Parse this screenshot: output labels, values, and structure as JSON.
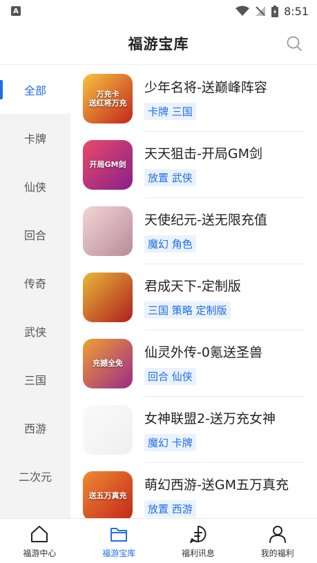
{
  "status_bar": {
    "notification_badge": "A",
    "time": "8:51"
  },
  "header": {
    "title": "福游宝库"
  },
  "categories": [
    {
      "label": "全部",
      "active": true
    },
    {
      "label": "卡牌",
      "active": false
    },
    {
      "label": "仙侠",
      "active": false
    },
    {
      "label": "回合",
      "active": false
    },
    {
      "label": "传奇",
      "active": false
    },
    {
      "label": "武侠",
      "active": false
    },
    {
      "label": "三国",
      "active": false
    },
    {
      "label": "西游",
      "active": false
    },
    {
      "label": "二次元",
      "active": false
    }
  ],
  "games": [
    {
      "title": "少年名将-送巅峰阵容",
      "tags": "卡牌 三国",
      "icon_text": "万充卡\n送红将万充",
      "icon_colors": [
        "#f6c340",
        "#c2261c"
      ]
    },
    {
      "title": "天天狙击-开局GM剑",
      "tags": "放置 武侠",
      "icon_text": "开局GM剑",
      "icon_colors": [
        "#e94a6a",
        "#8a1f8a"
      ]
    },
    {
      "title": "天使纪元-送无限充值",
      "tags": "魔幻 角色",
      "icon_text": "",
      "icon_colors": [
        "#f2d6d6",
        "#b98a9a"
      ]
    },
    {
      "title": "君成天下-定制版",
      "tags": "三国 策略 定制版",
      "icon_text": "",
      "icon_colors": [
        "#e8b83a",
        "#b01e1e"
      ]
    },
    {
      "title": "仙灵外传-0氪送圣兽",
      "tags": "回合 仙侠",
      "icon_text": "充撼全免",
      "icon_colors": [
        "#f0a030",
        "#9b2a8a"
      ]
    },
    {
      "title": "女神联盟2-送万充女神",
      "tags": "魔幻 卡牌",
      "icon_text": "",
      "icon_colors": [
        "#fafafa",
        "#f0f0f0"
      ]
    },
    {
      "title": "萌幻西游-送GM五万真充",
      "tags": "放置 西游",
      "icon_text": "送五万真充",
      "icon_colors": [
        "#f08a30",
        "#c2261c"
      ]
    }
  ],
  "bottom_nav": [
    {
      "label": "福游中心",
      "icon": "home-icon",
      "active": false
    },
    {
      "label": "福游宝库",
      "icon": "folder-icon",
      "active": true
    },
    {
      "label": "福利讯息",
      "icon": "chat-icon",
      "active": false
    },
    {
      "label": "我的福利",
      "icon": "user-icon",
      "active": false
    }
  ],
  "colors": {
    "accent": "#1f6fe5",
    "tag_bg": "#eaf2fd",
    "sidebar_bg": "#f3f3f3"
  }
}
